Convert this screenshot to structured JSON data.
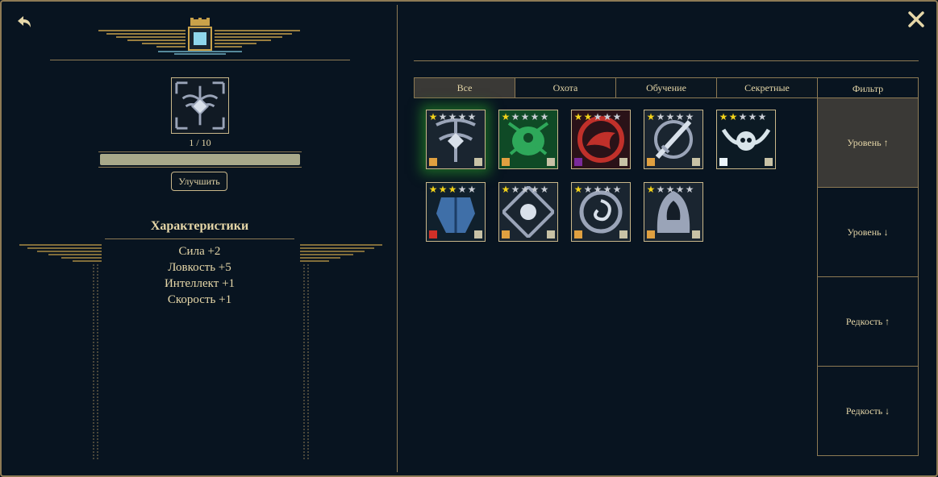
{
  "left": {
    "level_text": "1 / 10",
    "xp_progress": 1.0,
    "upgrade_label": "Улучшить",
    "stats_title": "Характеристики",
    "stats": [
      "Сила +2",
      "Ловкость +5",
      "Интеллект +1",
      "Скорость +1"
    ]
  },
  "tabs": [
    {
      "label": "Все",
      "active": true
    },
    {
      "label": "Охота",
      "active": false
    },
    {
      "label": "Обучение",
      "active": false
    },
    {
      "label": "Секретные",
      "active": false
    }
  ],
  "filter": {
    "title": "Фильтр",
    "options": [
      {
        "label": "Уровень ↑",
        "active": true
      },
      {
        "label": "Уровень ↓",
        "active": false
      },
      {
        "label": "Редкость ↑",
        "active": false
      },
      {
        "label": "Редкость ↓",
        "active": false
      }
    ]
  },
  "items": [
    {
      "name": "crossbow-emblem",
      "stars": 1,
      "selected": true,
      "badge": "#e0a040",
      "bg": "#1a2530",
      "art": "#9aa4b8"
    },
    {
      "name": "green-beast",
      "stars": 1,
      "selected": false,
      "badge": "#e0a040",
      "bg": "#0f4a26",
      "art": "#2ea85a"
    },
    {
      "name": "red-dragon",
      "stars": 2,
      "selected": false,
      "badge": "#7a2a9a",
      "bg": "#2a1218",
      "art": "#c0302a"
    },
    {
      "name": "sword-ring",
      "stars": 1,
      "selected": false,
      "badge": "#e0a040",
      "bg": "#1a2530",
      "art": "#9aa4b8"
    },
    {
      "name": "winged-skull",
      "stars": 2,
      "selected": false,
      "badge": "#eaf4fa",
      "bg": "#0c1a24",
      "art": "#d8e4ea"
    },
    {
      "name": "blue-armor",
      "stars": 3,
      "selected": false,
      "badge": "#d03028",
      "bg": "#10202c",
      "art": "#3f6fa8"
    },
    {
      "name": "ornate-crest",
      "stars": 1,
      "selected": false,
      "badge": "#e0a040",
      "bg": "#1a2530",
      "art": "#9aa4b8"
    },
    {
      "name": "spiral-orb",
      "stars": 1,
      "selected": false,
      "badge": "#e0a040",
      "bg": "#1a2530",
      "art": "#9aa4b8"
    },
    {
      "name": "hooded-figure",
      "stars": 1,
      "selected": false,
      "badge": "#e0a040",
      "bg": "#1a2530",
      "art": "#9aa4b8"
    }
  ],
  "colors": {
    "gold": "#c9b78a",
    "star_on": "#f2d21a",
    "star_off": "#c8ccd4"
  }
}
